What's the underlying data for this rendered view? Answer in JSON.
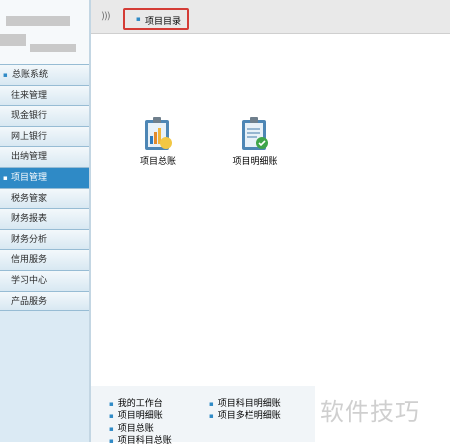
{
  "menu": {
    "items": [
      {
        "label": "总账系统",
        "bullet": "▪",
        "head": true
      },
      {
        "label": "往来管理"
      },
      {
        "label": "现金银行"
      },
      {
        "label": "网上银行"
      },
      {
        "label": "出纳管理"
      },
      {
        "label": "项目管理",
        "bullet": "▪",
        "active": true
      },
      {
        "label": "税务管家"
      },
      {
        "label": "财务报表"
      },
      {
        "label": "财务分析"
      },
      {
        "label": "信用服务"
      },
      {
        "label": "学习中心"
      },
      {
        "label": "产品服务"
      }
    ]
  },
  "topbar": {
    "chevrons": ")))",
    "breadcrumb": "项目目录",
    "bullet": "▪"
  },
  "main": {
    "icons": [
      {
        "label": "项目总账",
        "icon": "ledger-chart-icon"
      },
      {
        "label": "项目明细账",
        "icon": "ledger-detail-icon"
      }
    ]
  },
  "bottom_links": [
    "我的工作台",
    "项目明细账",
    "项目总账",
    "项目科目总账",
    "项目科目明细账",
    "项目多栏明细账"
  ],
  "watermark": "软件技巧",
  "colors": {
    "accent": "#2f8ac6",
    "highlight": "#d43c36"
  }
}
